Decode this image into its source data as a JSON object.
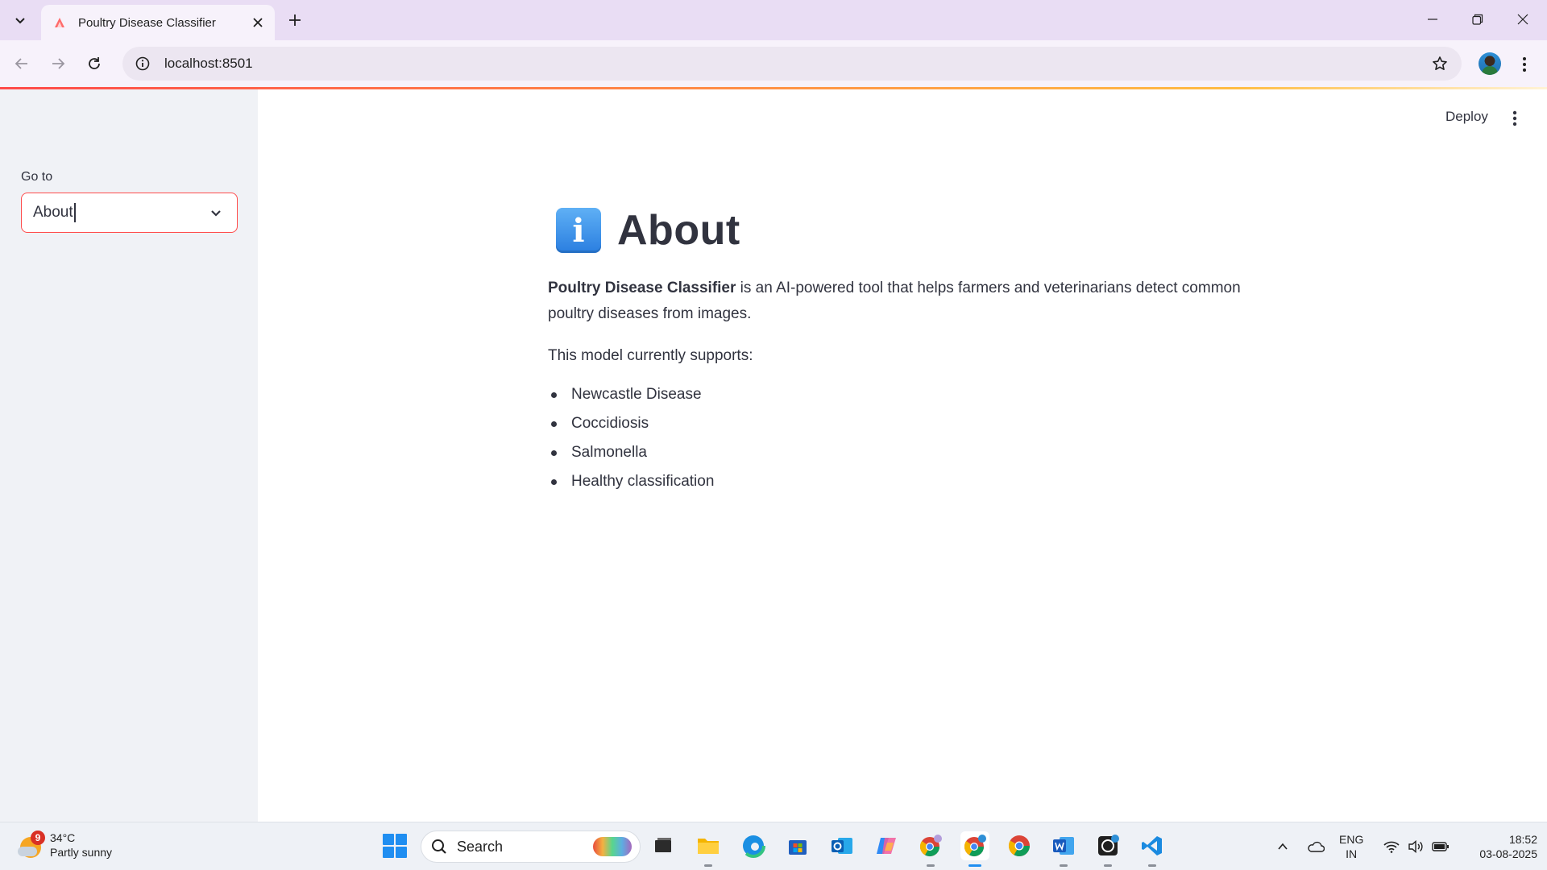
{
  "browser": {
    "tab_title": "Poultry Disease Classifier",
    "url": "localhost:8501"
  },
  "sidebar": {
    "label": "Go to",
    "select_value": "About"
  },
  "header": {
    "deploy_label": "Deploy"
  },
  "main": {
    "title": "About",
    "intro_bold": "Poultry Disease Classifier",
    "intro_rest": " is an AI-powered tool that helps farmers and veterinarians detect common poultry diseases from images.",
    "supports_text": "This model currently supports:",
    "items": [
      "Newcastle Disease",
      "Coccidiosis",
      "Salmonella",
      "Healthy classification"
    ]
  },
  "taskbar": {
    "weather_badge": "9",
    "temperature": "34°C",
    "condition": "Partly sunny",
    "search_placeholder": "Search",
    "lang_line1": "ENG",
    "lang_line2": "IN",
    "time": "18:52",
    "date": "03-08-2025",
    "apps": [
      "task-view",
      "file-explorer",
      "edge",
      "microsoft-store",
      "outlook",
      "copilot",
      "chrome-profile-1",
      "chrome-profile-2",
      "chrome",
      "word",
      "github-desktop",
      "vscode"
    ]
  },
  "colors": {
    "accent": "#ff4b4b",
    "sidebar_bg": "#f0f2f6",
    "text": "#31333f",
    "chrome_frame": "#e9ddf4"
  }
}
